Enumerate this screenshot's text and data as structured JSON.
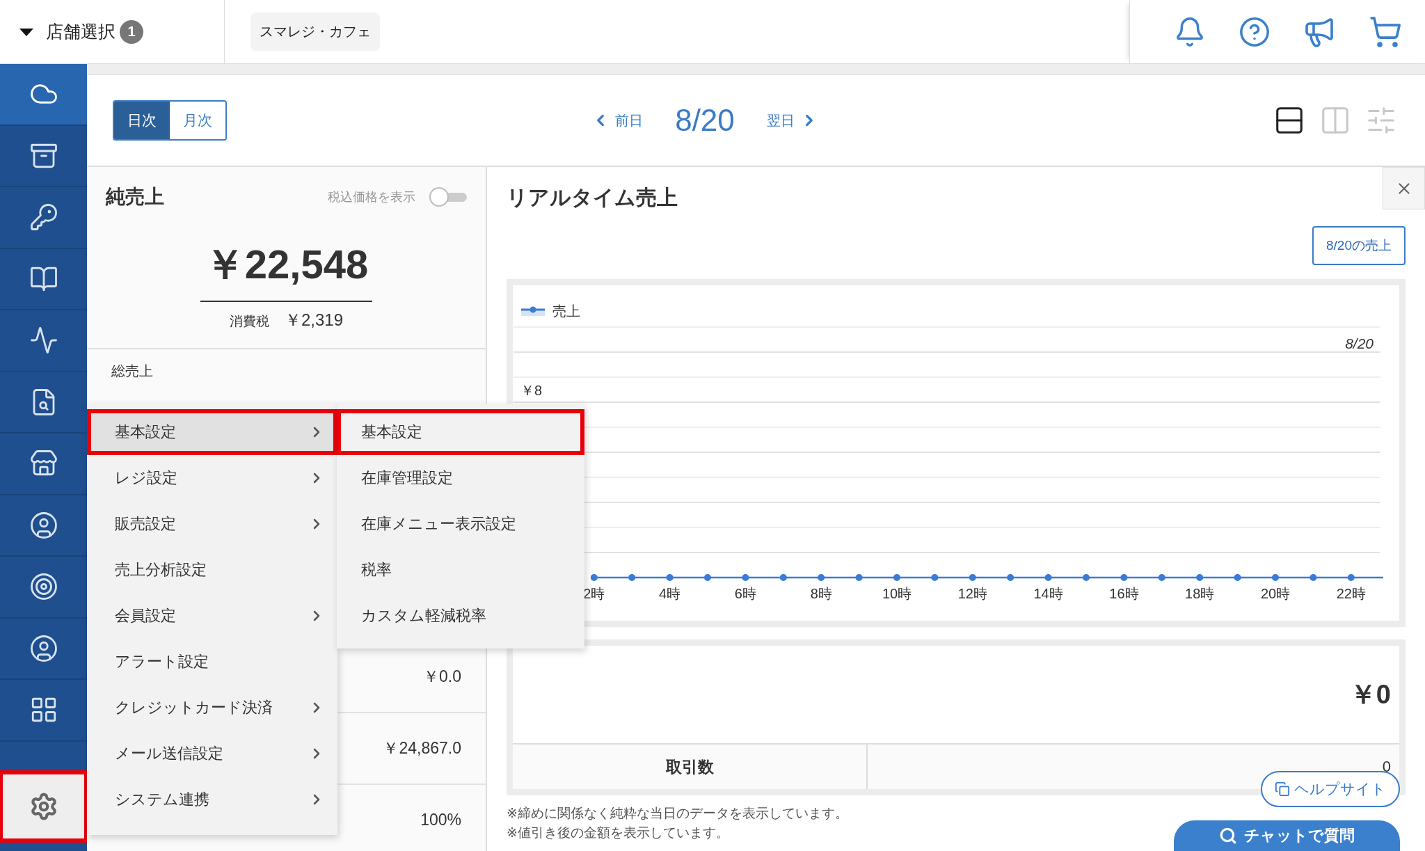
{
  "header": {
    "store_selector": {
      "label": "店舗選択",
      "badge": "1",
      "expanded": true
    },
    "store": "スマレジ・カフェ"
  },
  "sidebar": {
    "items": [
      {
        "kind": "cloud",
        "selected": true
      },
      {
        "kind": "archive",
        "selected": false
      },
      {
        "kind": "key",
        "selected": false
      },
      {
        "kind": "book",
        "selected": false
      },
      {
        "kind": "trend",
        "selected": false
      },
      {
        "kind": "report",
        "selected": false
      },
      {
        "kind": "store",
        "selected": false
      },
      {
        "kind": "user",
        "selected": false
      },
      {
        "kind": "target",
        "selected": false
      },
      {
        "kind": "user",
        "selected": false
      },
      {
        "kind": "grid",
        "selected": false
      }
    ],
    "settings": {
      "open": true,
      "highlighted": true
    }
  },
  "toolbar": {
    "period_tabs": [
      {
        "label": "日次",
        "selected": true
      },
      {
        "label": "月次",
        "selected": false
      }
    ],
    "date_nav": {
      "prev": "前日",
      "date": "8/20",
      "next": "翌日"
    },
    "layout_buttons": [
      {
        "kind": "rows",
        "selected": true
      },
      {
        "kind": "columns",
        "selected": false
      },
      {
        "kind": "sliders",
        "selected": false
      }
    ]
  },
  "net_sales": {
    "title": "純売上",
    "tax_toggle": {
      "label": "税込価格を表示",
      "on": false
    },
    "amount": "￥22,548",
    "tax_label": "消費税",
    "tax_amount": "￥2,319",
    "rows": [
      {
        "label": "総売上"
      },
      {
        "value": "￥0.0"
      },
      {
        "value": "￥24,867.0"
      },
      {
        "value": "100%"
      }
    ]
  },
  "realtime": {
    "title": "リアルタイム売上",
    "date_button": "8/20の売上",
    "chart": {
      "legend": "売上",
      "date_label": "8/20",
      "y_label": "￥8",
      "x_labels": [
        "2時",
        "4時",
        "6時",
        "8時",
        "10時",
        "12時",
        "14時",
        "16時",
        "18時",
        "20時",
        "22時"
      ]
    },
    "summary": {
      "total": "￥0",
      "rows": [
        {
          "label": "取引数",
          "value": "0"
        }
      ]
    },
    "notes": [
      "※締めに関係なく純粋な当日のデータを表示しています。",
      "※値引き後の金額を表示しています。"
    ]
  },
  "menu": {
    "items": [
      {
        "label": "基本設定",
        "has_submenu": true,
        "selected": true,
        "highlighted": true
      },
      {
        "label": "レジ設定",
        "has_submenu": true,
        "selected": false,
        "highlighted": false
      },
      {
        "label": "販売設定",
        "has_submenu": true,
        "selected": false,
        "highlighted": false
      },
      {
        "label": "売上分析設定",
        "has_submenu": false,
        "selected": false,
        "highlighted": false
      },
      {
        "label": "会員設定",
        "has_submenu": true,
        "selected": false,
        "highlighted": false
      },
      {
        "label": "アラート設定",
        "has_submenu": false,
        "selected": false,
        "highlighted": false
      },
      {
        "label": "クレジットカード決済",
        "has_submenu": true,
        "selected": false,
        "highlighted": false
      },
      {
        "label": "メール送信設定",
        "has_submenu": true,
        "selected": false,
        "highlighted": false
      },
      {
        "label": "システム連携",
        "has_submenu": true,
        "selected": false,
        "highlighted": false
      }
    ]
  },
  "submenu": {
    "items": [
      {
        "label": "基本設定",
        "highlighted": true
      },
      {
        "label": "在庫管理設定",
        "highlighted": false
      },
      {
        "label": "在庫メニュー表示設定",
        "highlighted": false
      },
      {
        "label": "税率",
        "highlighted": false
      },
      {
        "label": "カスタム軽減税率",
        "highlighted": false
      }
    ]
  },
  "help_button": "ヘルプサイト",
  "chat_button": "チャットで質問"
}
